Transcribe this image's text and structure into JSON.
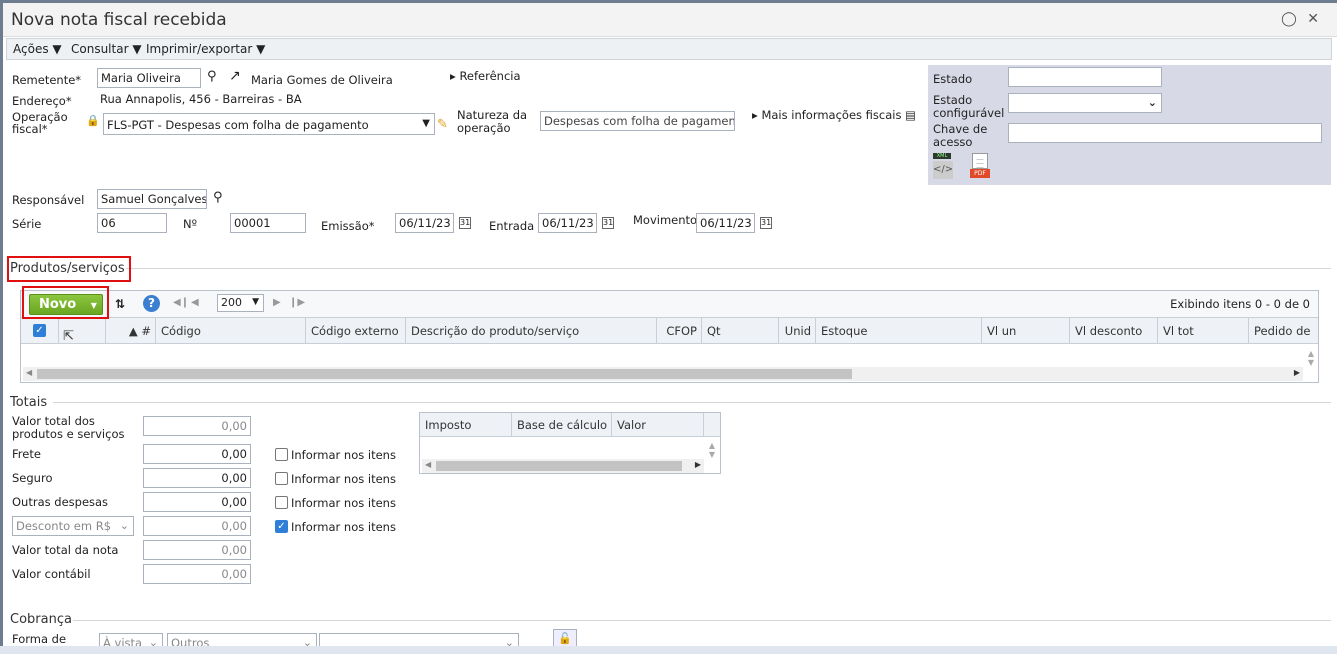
{
  "window": {
    "title": "Nova nota fiscal recebida"
  },
  "menubar": {
    "items": [
      "Ações ▼",
      "Consultar ▼",
      "Imprimir/exportar ▼"
    ]
  },
  "header": {
    "remetente_label": "Remetente*",
    "remetente_value": "Maria Oliveira",
    "remetente_name": "Maria Gomes de Oliveira",
    "referencia": "Referência",
    "endereco_label": "Endereço*",
    "endereco_value": "Rua Annapolis, 456 - Barreiras - BA",
    "operacao_label1": "Operação",
    "operacao_label2": "fiscal*",
    "operacao_value": "FLS-PGT - Despesas com folha de pagamento",
    "natureza_label1": "Natureza da",
    "natureza_label2": "operação",
    "natureza_value": "Despesas com folha de pagamento",
    "mais_info": "Mais informações fiscais",
    "responsavel_label": "Responsável",
    "responsavel_value": "Samuel Gonçalves",
    "serie_label": "Série",
    "serie_value": "06",
    "numero_label": "Nº",
    "numero_value": "00001",
    "emissao_label": "Emissão*",
    "emissao_value": "06/11/23",
    "entrada_label": "Entrada",
    "entrada_value": "06/11/23",
    "movimento_label": "Movimento",
    "movimento_value": "06/11/23"
  },
  "fiscal": {
    "estado_label": "Estado",
    "estado_conf_label1": "Estado",
    "estado_conf_label2": "configurável",
    "chave_label1": "Chave de",
    "chave_label2": "acesso",
    "xml_tag": "XML",
    "pdf_tag": "PDF"
  },
  "produtos": {
    "section_title": "Produtos/serviços",
    "novo_label": "Novo",
    "page_size": "200",
    "showing": "Exibindo itens 0 - 0 de 0",
    "columns": [
      "▲ #",
      "Código",
      "Código externo",
      "Descrição do produto/serviço",
      "CFOP",
      "Qt",
      "Unid",
      "Estoque",
      "Vl un",
      "Vl desconto",
      "Vl tot",
      "Pedido de"
    ]
  },
  "totais": {
    "section_title": "Totais",
    "valor_total_label1": "Valor total dos",
    "valor_total_label2": "produtos e serviços",
    "valor_total_value": "0,00",
    "frete_label": "Frete",
    "frete_value": "0,00",
    "seguro_label": "Seguro",
    "seguro_value": "0,00",
    "outras_label": "Outras despesas",
    "outras_value": "0,00",
    "desconto_select": "Desconto em R$",
    "desconto_value": "0,00",
    "valor_nota_label": "Valor total da nota",
    "valor_nota_value": "0,00",
    "valor_contabil_label": "Valor contábil",
    "valor_contabil_value": "0,00",
    "informar_label": "Informar nos itens",
    "tax_columns": [
      "Imposto",
      "Base de cálculo",
      "Valor"
    ]
  },
  "cobranca": {
    "section_title": "Cobrança",
    "forma_label": "Forma de",
    "avista": "À vista",
    "outros": "Outros"
  },
  "colors": {
    "novo_green": "#7ab72f",
    "highlight_red": "#e01010",
    "fiscal_panel": "#d8d9e6"
  }
}
